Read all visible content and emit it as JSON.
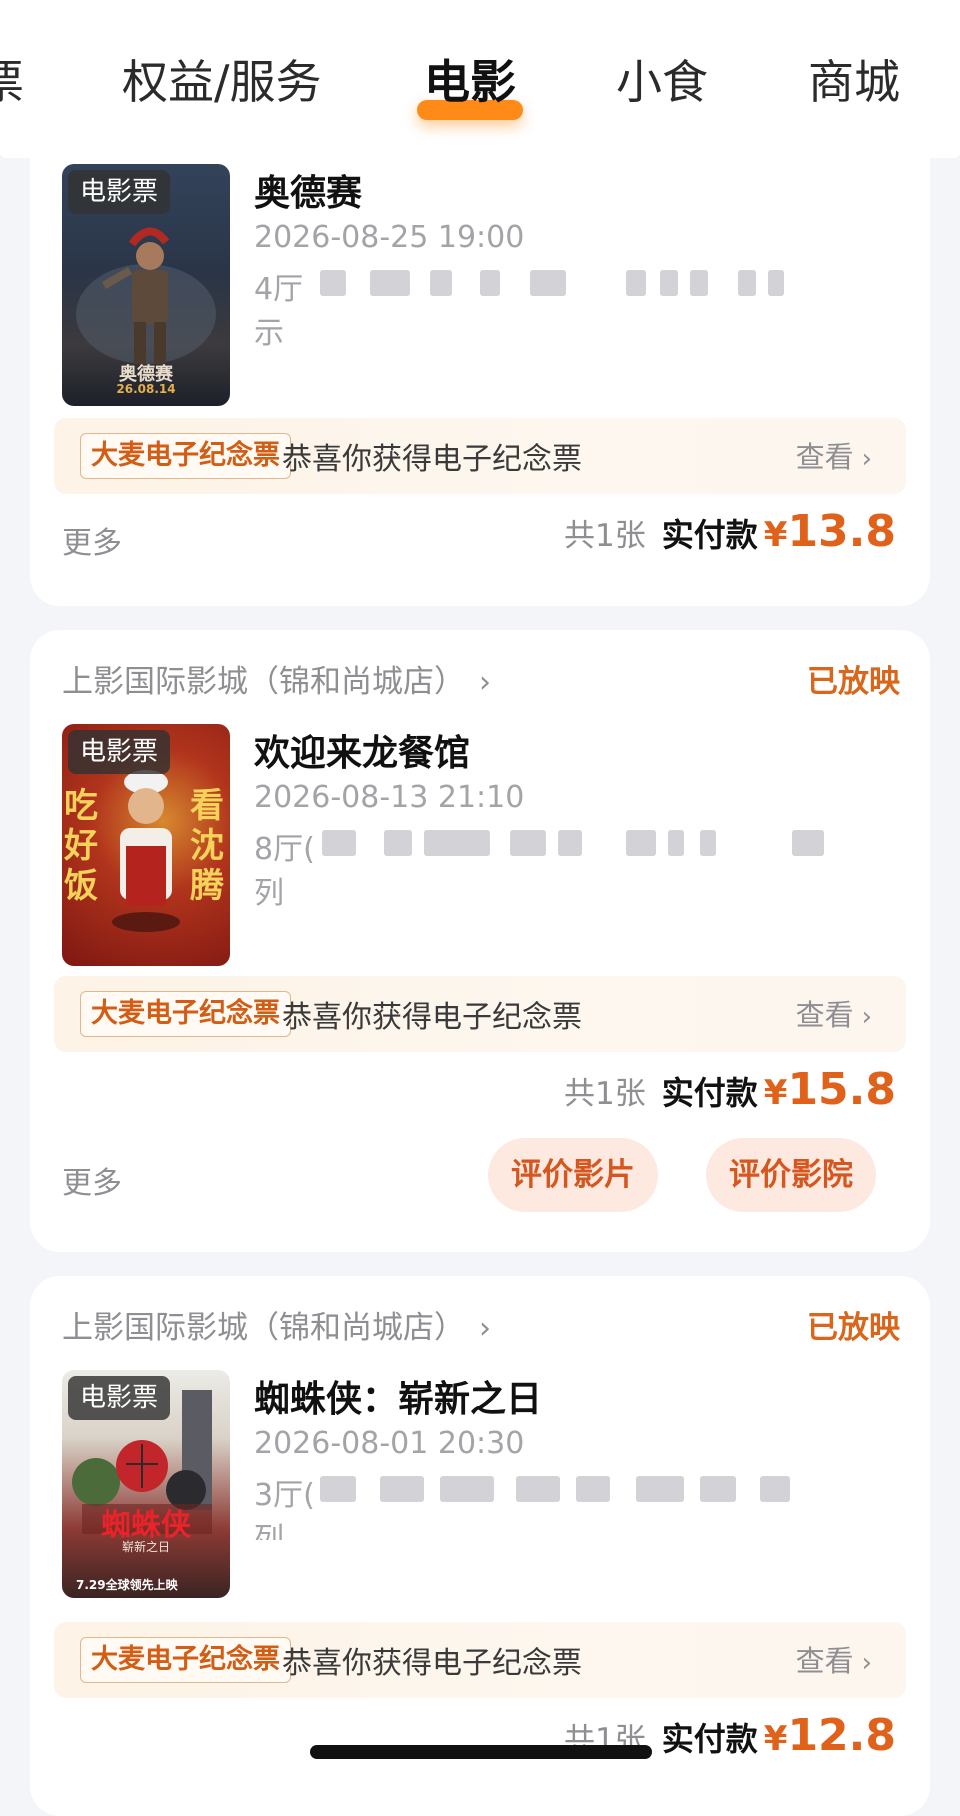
{
  "tabs": [
    "票",
    "权益/服务",
    "电影",
    "小食",
    "商城"
  ],
  "active_tab": "电影",
  "orders": [
    {
      "cinema": "",
      "status": "",
      "poster_tag": "电影票",
      "title": "奥德赛",
      "datetime": "2026-08-25 19:00",
      "hall_prefix": "4厅",
      "seat_suffix": "示",
      "souvenir_badge": "大麦电子纪念票",
      "souvenir_text": "恭喜你获得电子纪念票",
      "souvenir_link": "查看",
      "more": "更多",
      "count": "共1张",
      "paid_label": "实付款",
      "currency": "¥",
      "price": "13.8",
      "poster_text": "奥德赛",
      "poster_date": "26.08.14",
      "poster_colors": [
        "#263447",
        "#6b5541"
      ]
    },
    {
      "cinema": "上影国际影城（锦和尚城店）",
      "status": "已放映",
      "poster_tag": "电影票",
      "title": "欢迎来龙餐馆",
      "datetime": "2026-08-13 21:10",
      "hall_prefix": "8厅(",
      "seat_suffix": "列",
      "souvenir_badge": "大麦电子纪念票",
      "souvenir_text": "恭喜你获得电子纪念票",
      "souvenir_link": "查看",
      "more": "更多",
      "count": "共1张",
      "paid_label": "实付款",
      "currency": "¥",
      "price": "15.8",
      "buttons": [
        "评价影片",
        "评价影院"
      ],
      "poster_text_left": "吃好饭",
      "poster_text_right": "看沈腾",
      "poster_colors": [
        "#8f1a14",
        "#c4411f"
      ]
    },
    {
      "cinema": "上影国际影城（锦和尚城店）",
      "status": "已放映",
      "poster_tag": "电影票",
      "title": "蜘蛛侠：崭新之日",
      "datetime": "2026-08-01 20:30",
      "hall_prefix": "3厅(",
      "seat_suffix": "列",
      "souvenir_badge": "大麦电子纪念票",
      "souvenir_text": "恭喜你获得电子纪念票",
      "souvenir_link": "查看",
      "count": "共1张",
      "paid_label": "实付款",
      "currency": "¥",
      "price": "12.8",
      "poster_text": "蜘蛛侠",
      "poster_subtext": "崭新之日",
      "poster_date": "7.29全球领先上映",
      "poster_colors": [
        "#e7e3dc",
        "#8a2a2a"
      ]
    }
  ],
  "icons": {
    "chevron": "chevron-right-icon"
  }
}
